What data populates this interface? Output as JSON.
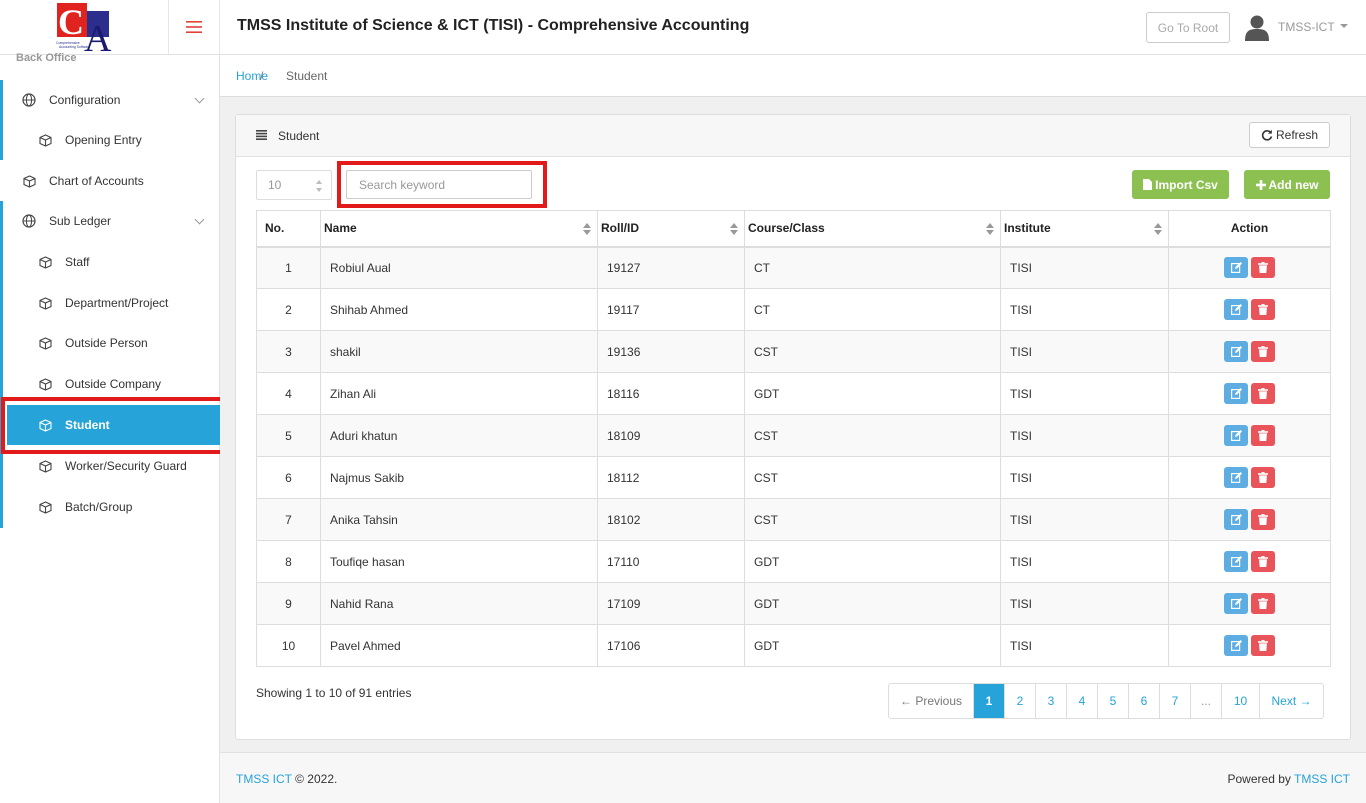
{
  "header": {
    "app_title": "TMSS Institute of Science & ICT (TISI) - Comprehensive Accounting",
    "go_root_label": "Go To Root",
    "user_name": "TMSS-ICT",
    "logo_letters": "CA",
    "logo_subtext": "Comprehensive Accounting Software"
  },
  "sidebar": {
    "section_label": "Back Office",
    "items": [
      {
        "label": "Configuration"
      },
      {
        "label": "Opening Entry"
      },
      {
        "label": "Chart of Accounts"
      },
      {
        "label": "Sub Ledger"
      },
      {
        "label": "Staff"
      },
      {
        "label": "Department/Project"
      },
      {
        "label": "Outside Person"
      },
      {
        "label": "Outside Company"
      },
      {
        "label": "Student"
      },
      {
        "label": "Worker/Security Guard"
      },
      {
        "label": "Batch/Group"
      }
    ]
  },
  "breadcrumb": {
    "home": "Home",
    "separator": "/",
    "current": "Student"
  },
  "panel": {
    "title": "Student",
    "refresh_label": "Refresh",
    "page_length": "10",
    "search_placeholder": "Search keyword",
    "import_label": "Import Csv",
    "add_label": "Add new"
  },
  "table": {
    "headers": [
      "No.",
      "Name",
      "Roll/ID",
      "Course/Class",
      "Institute",
      "Action"
    ],
    "rows": [
      {
        "no": "1",
        "name": "Robiul Aual",
        "roll": "19127",
        "course": "CT",
        "institute": "TISI"
      },
      {
        "no": "2",
        "name": "Shihab Ahmed",
        "roll": "19117",
        "course": "CT",
        "institute": "TISI"
      },
      {
        "no": "3",
        "name": "shakil",
        "roll": "19136",
        "course": "CST",
        "institute": "TISI"
      },
      {
        "no": "4",
        "name": "Zihan Ali",
        "roll": "18116",
        "course": "GDT",
        "institute": "TISI"
      },
      {
        "no": "5",
        "name": "Aduri khatun",
        "roll": "18109",
        "course": "CST",
        "institute": "TISI"
      },
      {
        "no": "6",
        "name": "Najmus Sakib",
        "roll": "18112",
        "course": "CST",
        "institute": "TISI"
      },
      {
        "no": "7",
        "name": "Anika Tahsin",
        "roll": "18102",
        "course": "CST",
        "institute": "TISI"
      },
      {
        "no": "8",
        "name": "Toufiqe hasan",
        "roll": "17110",
        "course": "GDT",
        "institute": "TISI"
      },
      {
        "no": "9",
        "name": "Nahid Rana",
        "roll": "17109",
        "course": "GDT",
        "institute": "TISI"
      },
      {
        "no": "10",
        "name": "Pavel Ahmed",
        "roll": "17106",
        "course": "GDT",
        "institute": "TISI"
      }
    ]
  },
  "pagination": {
    "info": "Showing 1 to 10 of 91 entries",
    "previous": "← Previous",
    "pages": [
      "1",
      "2",
      "3",
      "4",
      "5",
      "6",
      "7",
      "...",
      "10"
    ],
    "current": "1",
    "next": "Next →"
  },
  "footer": {
    "left_link": "TMSS ICT",
    "left_text": " © 2022.",
    "right_text": "Powered by ",
    "right_link": "TMSS ICT"
  },
  "colors": {
    "accent": "#26a3d9",
    "green_button": "#8cc152",
    "edit_button": "#5dade2",
    "delete_button": "#e9545a",
    "highlight_box": "#e21a1a",
    "logo_red": "#e0231f",
    "logo_blue": "#2b2e8c"
  }
}
